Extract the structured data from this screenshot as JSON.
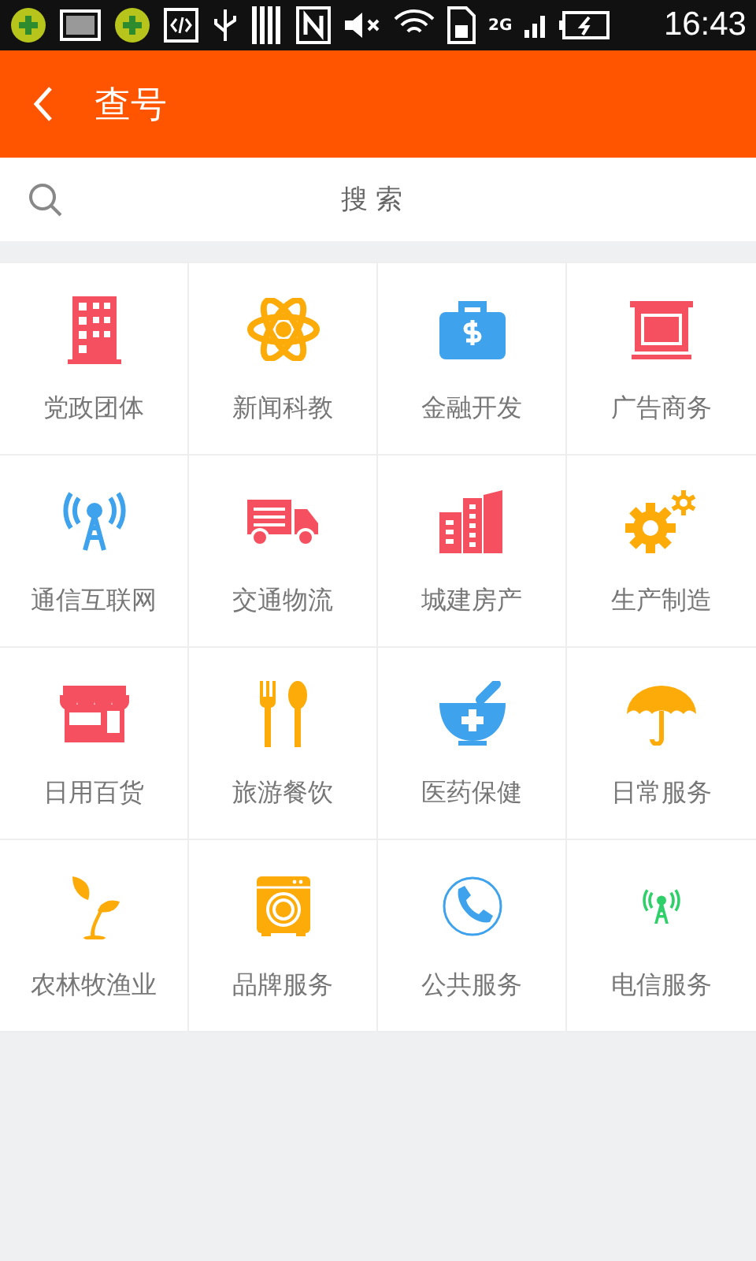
{
  "status_bar": {
    "network": "2G",
    "time": "16:43"
  },
  "header": {
    "title": "查号"
  },
  "search": {
    "placeholder": "搜 索"
  },
  "categories": [
    {
      "label": "党政团体",
      "kind": "building",
      "color": "#f5505f"
    },
    {
      "label": "新闻科教",
      "kind": "atom",
      "color": "#fcab08"
    },
    {
      "label": "金融开发",
      "kind": "briefcase",
      "color": "#3ea2ed"
    },
    {
      "label": "广告商务",
      "kind": "billboard",
      "color": "#f5505f"
    },
    {
      "label": "通信互联网",
      "kind": "tower",
      "color": "#3ea2ed"
    },
    {
      "label": "交通物流",
      "kind": "truck",
      "color": "#f5505f"
    },
    {
      "label": "城建房产",
      "kind": "city",
      "color": "#f5505f"
    },
    {
      "label": "生产制造",
      "kind": "gears",
      "color": "#fcab08"
    },
    {
      "label": "日用百货",
      "kind": "shop",
      "color": "#f5505f"
    },
    {
      "label": "旅游餐饮",
      "kind": "cutlery",
      "color": "#fcab08"
    },
    {
      "label": "医药保健",
      "kind": "mortar",
      "color": "#3ea2ed"
    },
    {
      "label": "日常服务",
      "kind": "umbrella",
      "color": "#fcab08"
    },
    {
      "label": "农林牧渔业",
      "kind": "plant",
      "color": "#fcab08"
    },
    {
      "label": "品牌服务",
      "kind": "washer",
      "color": "#fcab08"
    },
    {
      "label": "公共服务",
      "kind": "phone",
      "color": "#3ea2ed"
    },
    {
      "label": "电信服务",
      "kind": "small-tower",
      "color": "#2fcf6a"
    }
  ]
}
